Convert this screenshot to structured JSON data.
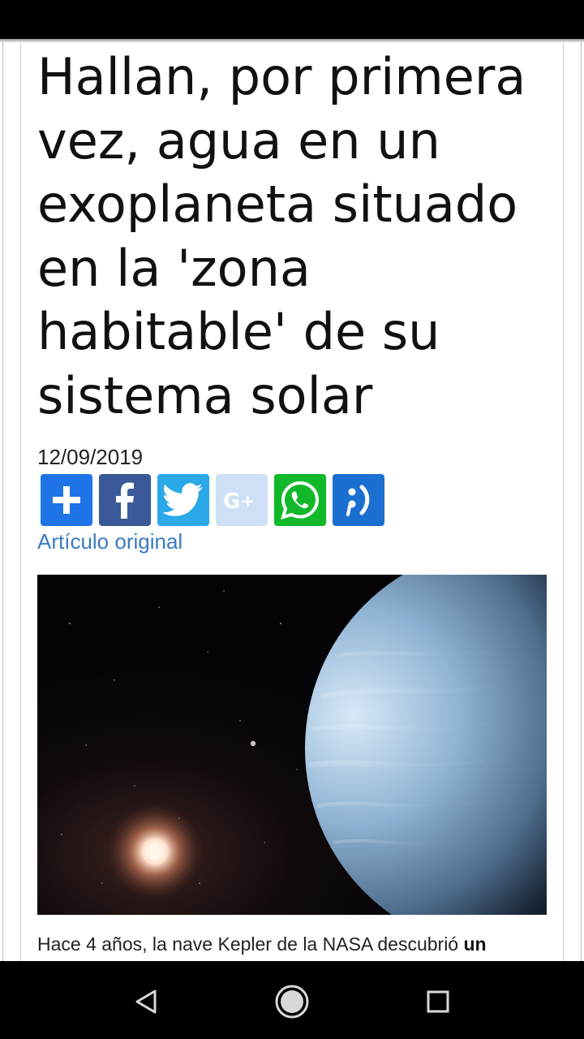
{
  "article": {
    "headline_lines": [
      "Hallan, por primera",
      "vez, agua en un",
      "exoplaneta situado",
      "en la 'zona",
      "habitable' de su",
      "sistema solar"
    ],
    "date": "12/09/2019",
    "original_link": "Artículo original",
    "body_start": "Hace 4 años, la nave Kepler de la NASA descubrió ",
    "body_bold": "un"
  },
  "share": {
    "buttons": [
      {
        "name": "share-add",
        "icon": "plus-icon",
        "color": "#1e73e6"
      },
      {
        "name": "share-facebook",
        "icon": "facebook-icon",
        "color": "#3b5998"
      },
      {
        "name": "share-twitter",
        "icon": "twitter-icon",
        "color": "#2aa8e8"
      },
      {
        "name": "share-googleplus",
        "icon": "googleplus-icon",
        "color": "#cfe0f6"
      },
      {
        "name": "share-whatsapp",
        "icon": "whatsapp-icon",
        "color": "#11b82a"
      },
      {
        "name": "share-meneame",
        "icon": "meneame-icon",
        "color": "#1a6fd0"
      }
    ]
  },
  "colors": {
    "link": "#3a7bbf",
    "status_bar": "#000000",
    "nav_bar": "#000000"
  },
  "navigation": {
    "back_icon": "triangle-back-icon",
    "home_icon": "circle-home-icon",
    "recents_icon": "square-recents-icon"
  }
}
